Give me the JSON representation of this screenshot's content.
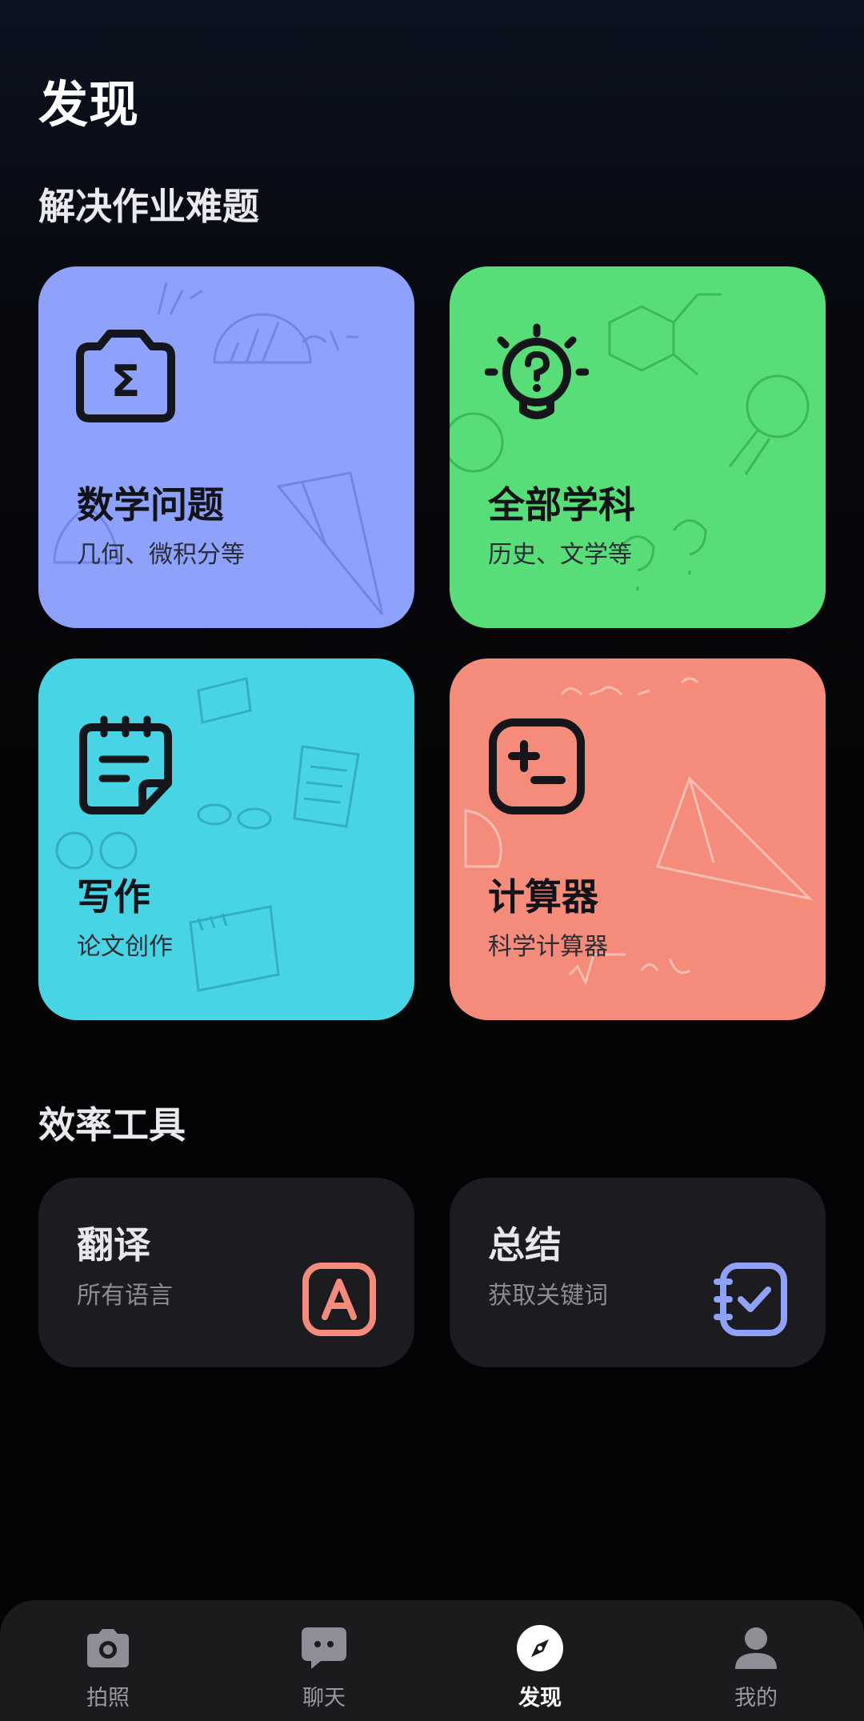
{
  "page": {
    "title": "发现"
  },
  "sections": {
    "homework": {
      "title": "解决作业难题"
    },
    "tools": {
      "title": "效率工具"
    }
  },
  "cards": [
    {
      "title": "数学问题",
      "subtitle": "几何、微积分等",
      "color": "#8ea2fb",
      "icon": "camera-sigma-icon"
    },
    {
      "title": "全部学科",
      "subtitle": "历史、文学等",
      "color": "#57de78",
      "icon": "lightbulb-question-icon"
    },
    {
      "title": "写作",
      "subtitle": "论文创作",
      "color": "#47d5e5",
      "icon": "notepad-icon"
    },
    {
      "title": "计算器",
      "subtitle": "科学计算器",
      "color": "#f58c7b",
      "icon": "calculator-icon"
    }
  ],
  "tools": [
    {
      "title": "翻译",
      "subtitle": "所有语言",
      "icon": "translate-icon",
      "icon_color": "#f58c7b"
    },
    {
      "title": "总结",
      "subtitle": "获取关键词",
      "icon": "summary-check-icon",
      "icon_color": "#8ea2fb"
    }
  ],
  "nav": {
    "items": [
      {
        "label": "拍照",
        "icon": "camera-icon"
      },
      {
        "label": "聊天",
        "icon": "chat-icon"
      },
      {
        "label": "发现",
        "icon": "compass-icon",
        "active": true
      },
      {
        "label": "我的",
        "icon": "user-icon"
      }
    ]
  },
  "colors": {
    "background": "#050507",
    "tool_card": "#1c1c20",
    "nav_bar": "#1b1b1e",
    "nav_inactive": "#9a9aa2",
    "nav_active": "#ffffff"
  }
}
